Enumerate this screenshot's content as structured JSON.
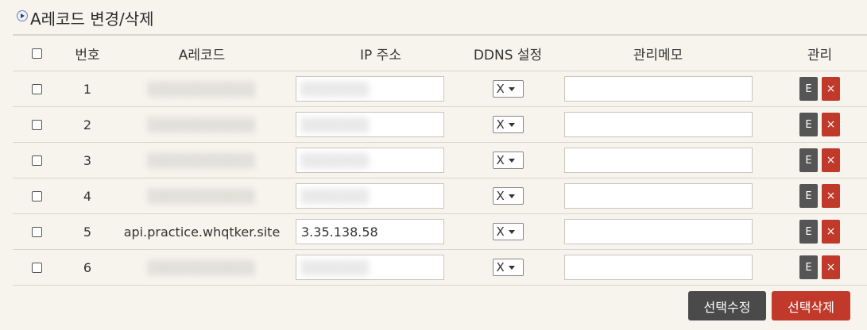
{
  "title": "A레코드 변경/삭제",
  "headers": {
    "number": "번호",
    "record": "A레코드",
    "ip": "IP 주소",
    "ddns": "DDNS 설정",
    "memo": "관리메모",
    "manage": "관리"
  },
  "rows": [
    {
      "number": "1",
      "record": "",
      "ip": "",
      "ddns": "X",
      "memo": "",
      "edit": "E",
      "delete": "×"
    },
    {
      "number": "2",
      "record": "",
      "ip": "",
      "ddns": "X",
      "memo": "",
      "edit": "E",
      "delete": "×"
    },
    {
      "number": "3",
      "record": "",
      "ip": "",
      "ddns": "X",
      "memo": "",
      "edit": "E",
      "delete": "×"
    },
    {
      "number": "4",
      "record": "",
      "ip": "",
      "ddns": "X",
      "memo": "",
      "edit": "E",
      "delete": "×"
    },
    {
      "number": "5",
      "record": "api.practice.whqtker.site",
      "ip": "3.35.138.58",
      "ddns": "X",
      "memo": "",
      "edit": "E",
      "delete": "×"
    },
    {
      "number": "6",
      "record": "",
      "ip": "",
      "ddns": "X",
      "memo": "",
      "edit": "E",
      "delete": "×"
    }
  ],
  "buttons": {
    "edit_selected": "선택수정",
    "delete_selected": "선택삭제"
  },
  "colors": {
    "background": "#f6f4ec",
    "edit_button": "#555555",
    "delete_button": "#c0392b"
  },
  "icons": {
    "title": "play-circle-icon",
    "delete": "close-icon",
    "select": "chevron-down-icon"
  }
}
